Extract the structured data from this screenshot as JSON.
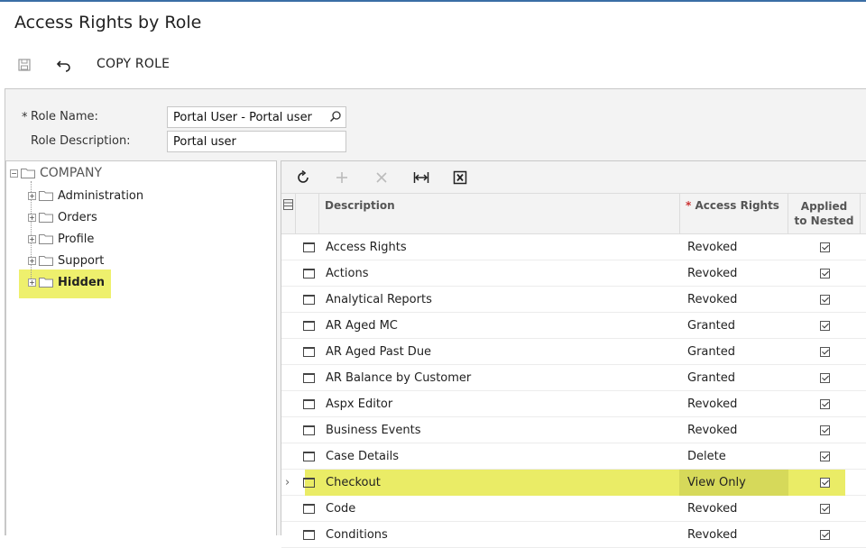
{
  "page": {
    "title": "Access Rights by Role"
  },
  "toolbar": {
    "save_icon": "save-icon",
    "undo_icon": "undo-icon",
    "copy_role_label": "COPY ROLE"
  },
  "form": {
    "role_name_label": "Role Name:",
    "role_name_required": "*",
    "role_name_value": "Portal User - Portal user",
    "role_description_label": "Role Description:",
    "role_description_value": "Portal user"
  },
  "tree": {
    "root": "COMPANY",
    "items": [
      {
        "label": "Administration"
      },
      {
        "label": "Orders"
      },
      {
        "label": "Profile"
      },
      {
        "label": "Support"
      },
      {
        "label": "Hidden"
      }
    ],
    "highlight_color": "#eef06d"
  },
  "grid": {
    "toolbar_icons": [
      "refresh-icon",
      "add-icon",
      "delete-icon",
      "fit-width-icon",
      "export-excel-icon"
    ],
    "columns": {
      "description": "Description",
      "access_rights_required": "*",
      "access_rights": "Access Rights",
      "applied_line1": "Applied",
      "applied_line2": "to Nested"
    },
    "rows": [
      {
        "description": "Access Rights",
        "access_rights": "Revoked",
        "applied": true
      },
      {
        "description": "Actions",
        "access_rights": "Revoked",
        "applied": true
      },
      {
        "description": "Analytical Reports",
        "access_rights": "Revoked",
        "applied": true
      },
      {
        "description": "AR Aged MC",
        "access_rights": "Granted",
        "applied": true
      },
      {
        "description": "AR Aged Past Due",
        "access_rights": "Granted",
        "applied": true
      },
      {
        "description": "AR Balance by Customer",
        "access_rights": "Granted",
        "applied": true
      },
      {
        "description": "Aspx Editor",
        "access_rights": "Revoked",
        "applied": true
      },
      {
        "description": "Business Events",
        "access_rights": "Revoked",
        "applied": true
      },
      {
        "description": "Case Details",
        "access_rights": "Delete",
        "applied": true
      },
      {
        "description": "Checkout",
        "access_rights": "View Only",
        "applied": true
      },
      {
        "description": "Code",
        "access_rights": "Revoked",
        "applied": true
      },
      {
        "description": "Conditions",
        "access_rights": "Revoked",
        "applied": true
      }
    ],
    "active_row_indicator": "›",
    "highlight_color": "#eaec66"
  }
}
